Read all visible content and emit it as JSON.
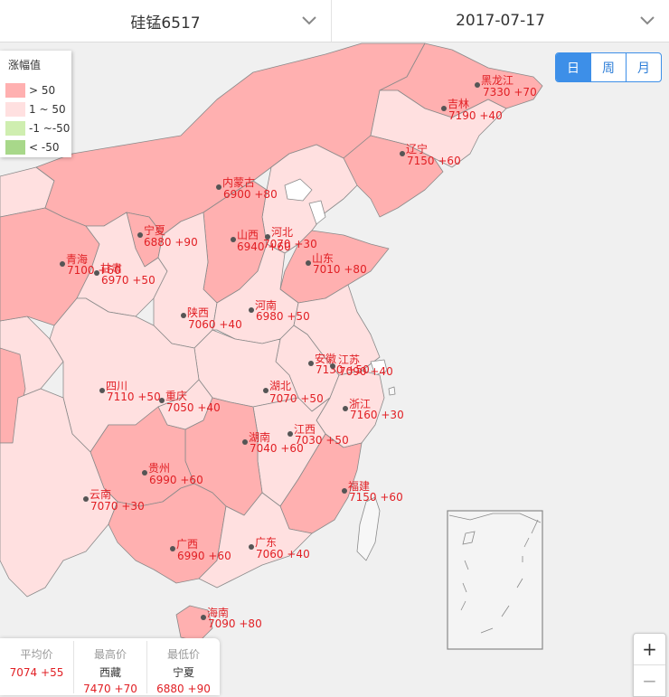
{
  "product_selector": {
    "label": "硅锰6517",
    "icon": "chevron-down-icon"
  },
  "date_selector": {
    "label": "2017-07-17",
    "icon": "chevron-down-icon"
  },
  "period_tabs": [
    {
      "label": "日",
      "active": true
    },
    {
      "label": "周",
      "active": false
    },
    {
      "label": "月",
      "active": false
    }
  ],
  "legend": {
    "title": "涨幅值",
    "items": [
      {
        "label": "> 50",
        "color": "#ffb0b0"
      },
      {
        "label": "1 ~ 50",
        "color": "#ffe0e0"
      },
      {
        "label": "-1 ~-50",
        "color": "#cfeeb0"
      },
      {
        "label": "< -50",
        "color": "#a8d88a"
      }
    ]
  },
  "zoom": {
    "in_label": "+",
    "out_label": "−"
  },
  "provinces": [
    {
      "name": "黑龙江",
      "price": "7330",
      "change": "+70"
    },
    {
      "name": "吉林",
      "price": "7190",
      "change": "+40"
    },
    {
      "name": "辽宁",
      "price": "7150",
      "change": "+60"
    },
    {
      "name": "内蒙古",
      "price": "6900",
      "change": "+80"
    },
    {
      "name": "宁夏",
      "price": "6880",
      "change": "+90"
    },
    {
      "name": "河北",
      "price": "7070",
      "change": "+30"
    },
    {
      "name": "山西",
      "price": "6940",
      "change": "+60"
    },
    {
      "name": "青海",
      "price": "7100",
      "change": "+60"
    },
    {
      "name": "甘肃",
      "price": "6970",
      "change": "+50"
    },
    {
      "name": "山东",
      "price": "7010",
      "change": "+80"
    },
    {
      "name": "河南",
      "price": "6980",
      "change": "+50"
    },
    {
      "name": "陕西",
      "price": "7060",
      "change": "+40"
    },
    {
      "name": "安徽",
      "price": "7130",
      "change": "+50"
    },
    {
      "name": "江苏",
      "price": "7090",
      "change": "+40"
    },
    {
      "name": "四川",
      "price": "7110",
      "change": "+50"
    },
    {
      "name": "湖北",
      "price": "7070",
      "change": "+50"
    },
    {
      "name": "重庆",
      "price": "7050",
      "change": "+40"
    },
    {
      "name": "浙江",
      "price": "7160",
      "change": "+30"
    },
    {
      "name": "江西",
      "price": "7030",
      "change": "+50"
    },
    {
      "name": "湖南",
      "price": "7040",
      "change": "+60"
    },
    {
      "name": "贵州",
      "price": "6990",
      "change": "+60"
    },
    {
      "name": "福建",
      "price": "7150",
      "change": "+60"
    },
    {
      "name": "云南",
      "price": "7070",
      "change": "+30"
    },
    {
      "name": "广西",
      "price": "6990",
      "change": "+60"
    },
    {
      "name": "广东",
      "price": "7060",
      "change": "+40"
    },
    {
      "name": "海南",
      "price": "7090",
      "change": "+80"
    }
  ],
  "stats": [
    {
      "label": "平均价",
      "name": "",
      "value": "7074 +55"
    },
    {
      "label": "最高价",
      "name": "西藏",
      "value": "7470 +70"
    },
    {
      "label": "最低价",
      "name": "宁夏",
      "value": "6880 +90"
    }
  ]
}
